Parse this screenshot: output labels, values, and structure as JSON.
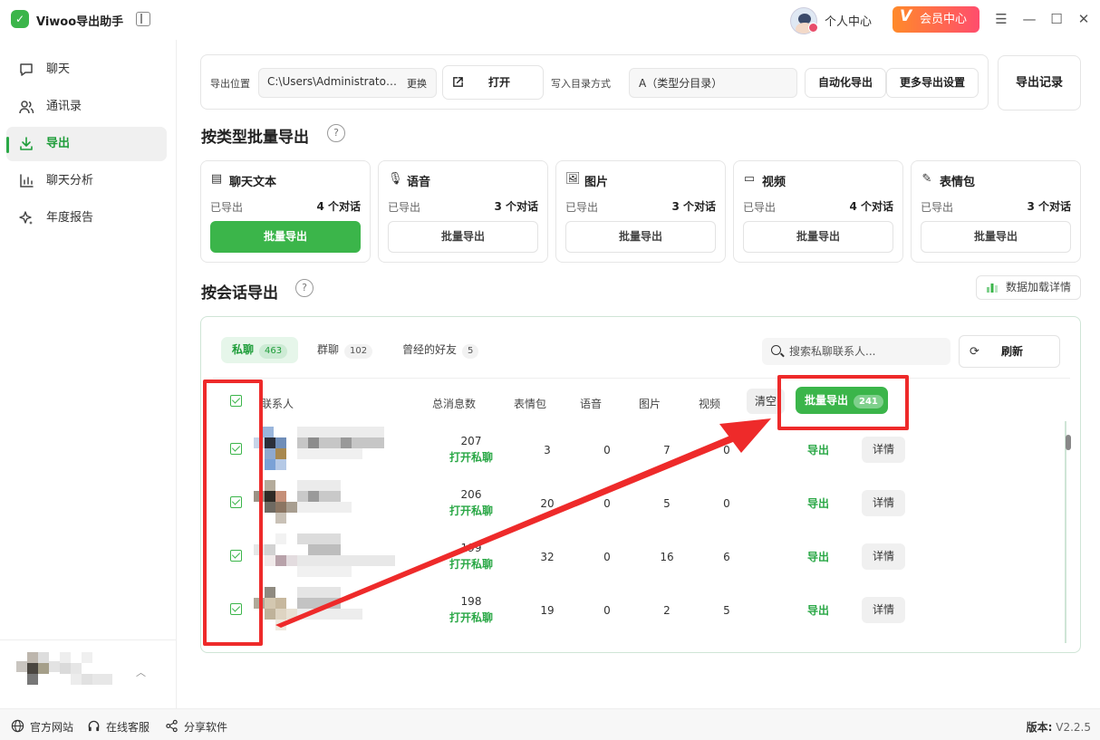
{
  "app": {
    "title": "Viwoo导出助手",
    "personal_center": "个人中心",
    "vip_center": "会员中心"
  },
  "sidebar": {
    "items": [
      {
        "label": "聊天",
        "icon": "chat-bubble-icon"
      },
      {
        "label": "通讯录",
        "icon": "contacts-icon"
      },
      {
        "label": "导出",
        "icon": "download-icon",
        "active": true
      },
      {
        "label": "聊天分析",
        "icon": "bar-chart-icon"
      },
      {
        "label": "年度报告",
        "icon": "sparkle-icon"
      }
    ]
  },
  "footer": {
    "official_site": "官方网站",
    "online_service": "在线客服",
    "share": "分享软件",
    "version_label": "版本:",
    "version": "V2.2.5"
  },
  "toolbar": {
    "export_location_label": "导出位置",
    "path": "C:\\Users\\Administrator\\Documents",
    "change": "更换",
    "open": "打开",
    "dir_mode_label": "写入目录方式",
    "dir_mode_value": "A（类型分目录）",
    "auto_export": "自动化导出",
    "more_settings": "更多导出设置",
    "export_record": "导出记录"
  },
  "type_section": {
    "title": "按类型批量导出",
    "exported_label": "已导出",
    "cards": [
      {
        "title": "聊天文本",
        "icon": "text-message-icon",
        "count": "4 个对话",
        "button": "批量导出",
        "primary": true
      },
      {
        "title": "语音",
        "icon": "microphone-icon",
        "count": "3 个对话",
        "button": "批量导出",
        "primary": false
      },
      {
        "title": "图片",
        "icon": "image-icon",
        "count": "3 个对话",
        "button": "批量导出",
        "primary": false
      },
      {
        "title": "视频",
        "icon": "video-icon",
        "count": "4 个对话",
        "button": "批量导出",
        "primary": false
      },
      {
        "title": "表情包",
        "icon": "magic-wand-icon",
        "count": "3 个对话",
        "button": "批量导出",
        "primary": false
      }
    ]
  },
  "session_section": {
    "title": "按会话导出",
    "data_details": "数据加载详情",
    "tabs": [
      {
        "label": "私聊",
        "count": "463",
        "active": true
      },
      {
        "label": "群聊",
        "count": "102",
        "active": false
      },
      {
        "label": "曾经的好友",
        "count": "5",
        "active": false
      }
    ],
    "search_placeholder": "搜索私聊联系人...",
    "refresh": "刷新",
    "columns": {
      "contact": "联系人",
      "total": "总消息数",
      "stickers": "表情包",
      "voice": "语音",
      "images": "图片",
      "video": "视频"
    },
    "clear": "清空",
    "batch_export": "批量导出",
    "batch_count": "241",
    "open_chat": "打开私聊",
    "export": "导出",
    "details": "详情",
    "rows": [
      {
        "total": "207",
        "stickers": "3",
        "voice": "0",
        "images": "7",
        "video": "0"
      },
      {
        "total": "206",
        "stickers": "20",
        "voice": "0",
        "images": "5",
        "video": "0"
      },
      {
        "total": "199",
        "stickers": "32",
        "voice": "0",
        "images": "16",
        "video": "6"
      },
      {
        "total": "198",
        "stickers": "19",
        "voice": "0",
        "images": "2",
        "video": "5"
      }
    ]
  },
  "colors": {
    "accent": "#3bb54a",
    "annotation_red": "#ee2a2a",
    "vip_gradient_start": "#ff8a2a",
    "vip_gradient_end": "#ff4d6d"
  }
}
